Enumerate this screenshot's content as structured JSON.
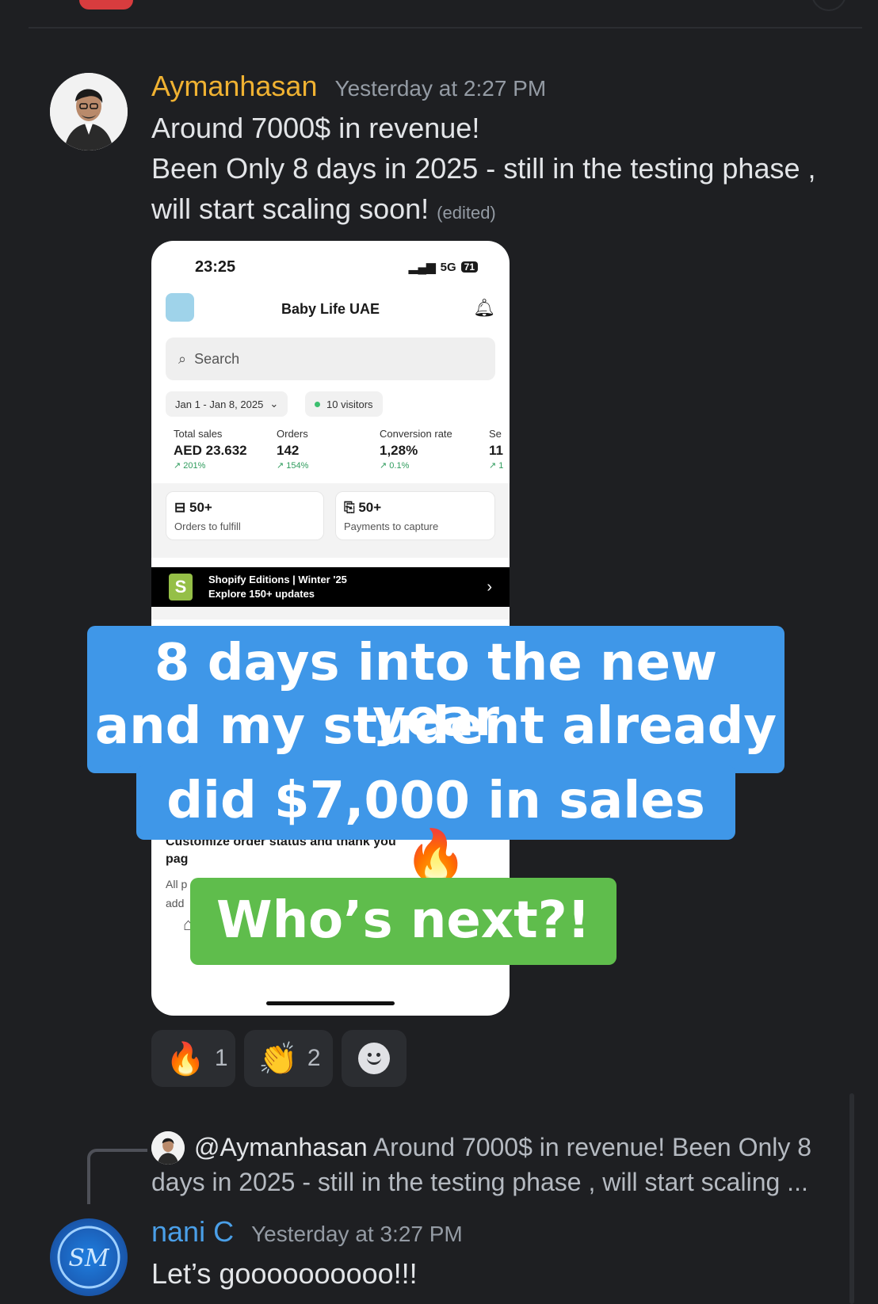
{
  "message1": {
    "username": "Aymanhasan",
    "timestamp": "Yesterday at 2:27 PM",
    "line1": "Around 7000$ in revenue!",
    "line2": "Been Only 8 days in 2025 - still in the testing phase ,",
    "line3": "will start scaling soon!",
    "edited": "(edited)"
  },
  "phone": {
    "time": "23:25",
    "network": "5G",
    "battery": "71",
    "store_name": "Baby Life UAE",
    "search_placeholder": "Search",
    "date_range": "Jan 1 - Jan 8, 2025",
    "visitors": "10 visitors",
    "metrics": [
      {
        "label": "Total sales",
        "value": "AED 23.632",
        "change": "↗ 201%"
      },
      {
        "label": "Orders",
        "value": "142",
        "change": "↗ 154%"
      },
      {
        "label": "Conversion rate",
        "value": "1,28%",
        "change": "↗ 0.1%"
      },
      {
        "label": "Se",
        "value": "11",
        "change": "↗ 1"
      }
    ],
    "card1": {
      "value": "50+",
      "label": "Orders to fulfill"
    },
    "card2": {
      "value": "50+",
      "label": "Payments to capture"
    },
    "banner_line1": "Shopify Editions | Winter '25",
    "banner_line2": "Explore 150+ updates",
    "customize_title_1": "Customize order status and thank you",
    "customize_title_2": "pag",
    "customize_sub_1": "All p",
    "customize_sub_2": "add"
  },
  "captions": {
    "blue_line1": "8 days into the new year",
    "blue_line2": "and my student already",
    "blue_line3": "did $7,000 in sales 🔥",
    "green": "Who’s next?!"
  },
  "reactions": [
    {
      "emoji": "🔥",
      "count": "1"
    },
    {
      "emoji": "👏",
      "count": "2"
    }
  ],
  "reply": {
    "mention": "@Aymanhasan",
    "preview_1": "Around 7000$ in revenue!  Been Only 8",
    "preview_2": "days in 2025 - still in the testing phase , will start scaling ..."
  },
  "message2": {
    "username": "nani C",
    "timestamp": "Yesterday at 3:27 PM",
    "text": "Let’s goooooooooo!!!"
  },
  "colors": {
    "background": "#1e1f22",
    "username_ayman": "#f0b232",
    "username_nani": "#4a9fe8",
    "caption_blue": "#3f97e8",
    "caption_green": "#5fbd4c"
  }
}
